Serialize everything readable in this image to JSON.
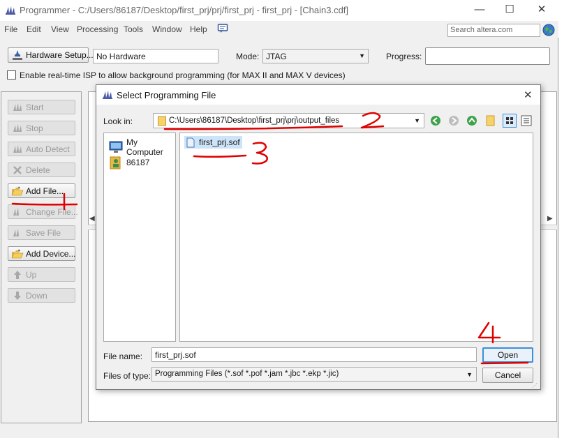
{
  "window": {
    "title": "Programmer - C:/Users/86187/Desktop/first_prj/prj/first_prj - first_prj - [Chain3.cdf]",
    "minimize": "—",
    "maximize": "☐",
    "close": "✕"
  },
  "menu": [
    "File",
    "Edit",
    "View",
    "Processing",
    "Tools",
    "Window",
    "Help"
  ],
  "search": {
    "placeholder": "Search altera.com"
  },
  "toolbar": {
    "hardware_setup_label": "Hardware Setup...",
    "hardware_value": "No Hardware",
    "mode_label": "Mode:",
    "mode_value": "JTAG",
    "progress_label": "Progress:",
    "progress_value": 0,
    "isp_label": "Enable real-time ISP to allow background programming (for MAX II and MAX V devices)",
    "isp_checked": false
  },
  "side_buttons": [
    {
      "label": "Start",
      "enabled": false
    },
    {
      "label": "Stop",
      "enabled": false
    },
    {
      "label": "Auto Detect",
      "enabled": false
    },
    {
      "label": "Delete",
      "enabled": false
    },
    {
      "label": "Add File...",
      "enabled": true
    },
    {
      "label": "Change File...",
      "enabled": false
    },
    {
      "label": "Save File",
      "enabled": false
    },
    {
      "label": "Add Device...",
      "enabled": true
    },
    {
      "label": "Up",
      "enabled": false
    },
    {
      "label": "Down",
      "enabled": false
    }
  ],
  "dialog": {
    "title": "Select Programming File",
    "close": "✕",
    "look_in_label": "Look in:",
    "look_in_path": "C:\\Users\\86187\\Desktop\\first_prj\\prj\\output_files",
    "places": [
      {
        "label": "My Computer",
        "icon": "computer-icon"
      },
      {
        "label": "86187",
        "icon": "user-folder-icon"
      }
    ],
    "files": [
      {
        "name": "first_prj.sof",
        "icon": "file-icon",
        "selected": true
      }
    ],
    "file_name_label": "File name:",
    "file_name_value": "first_prj.sof",
    "file_type_label": "Files of type:",
    "file_type_value": "Programming Files (*.sof *.pof *.jam *.jbc *.ekp *.jic)",
    "open_label": "Open",
    "cancel_label": "Cancel"
  },
  "annotations": {
    "color": "#e00000",
    "labels": [
      "1",
      "2",
      "3",
      "4"
    ]
  }
}
